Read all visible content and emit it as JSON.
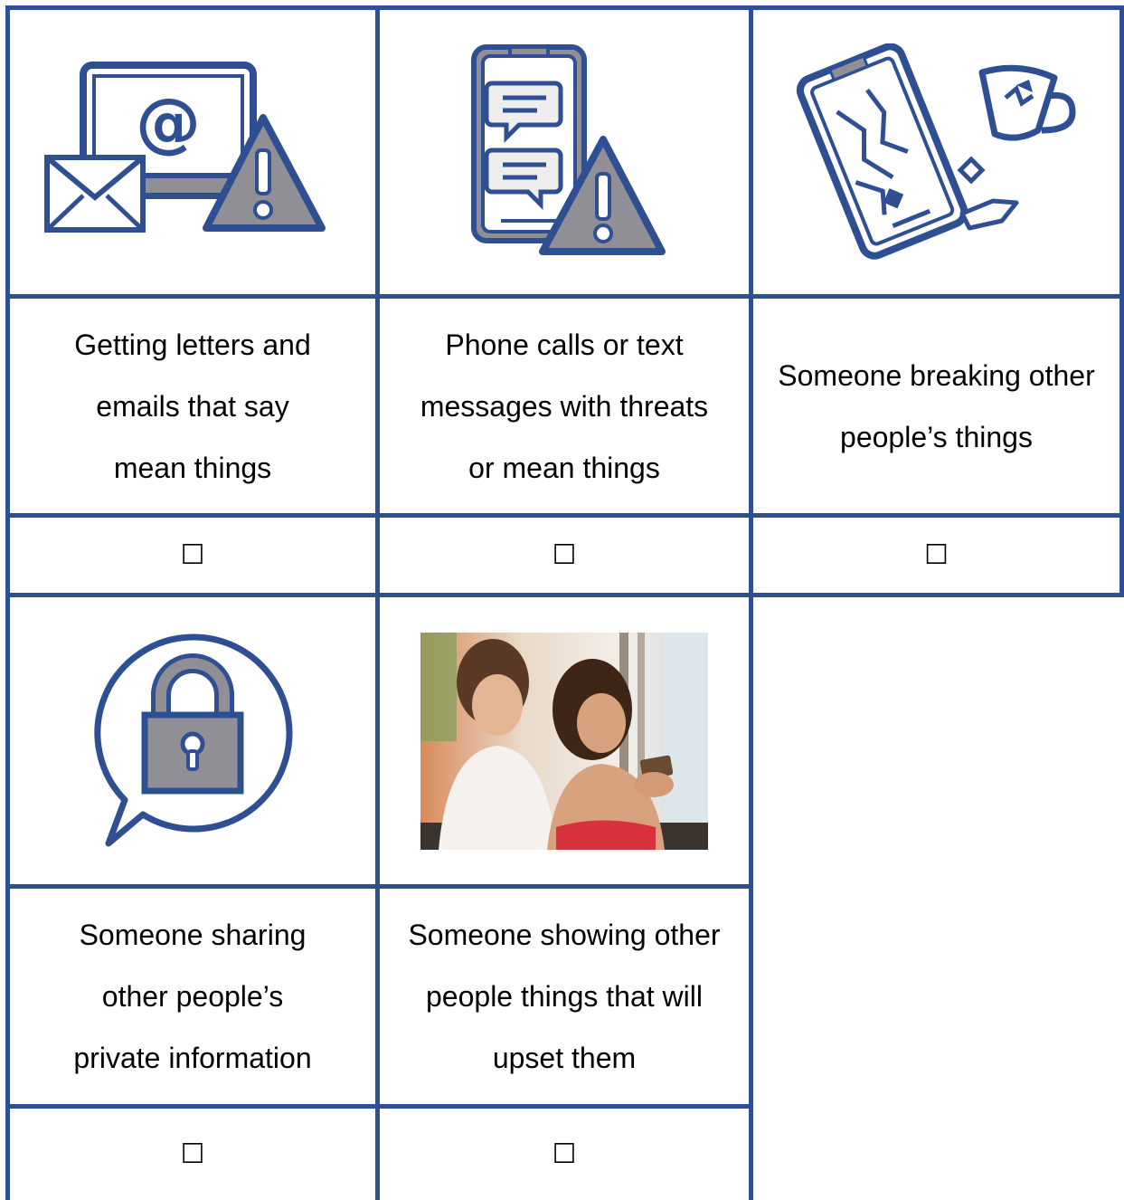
{
  "colors": {
    "border": "#2f4f93",
    "icon_stroke": "#2f4f93",
    "icon_fill": "#8f8f95",
    "paper": "#ffffff"
  },
  "items": [
    {
      "label": "Getting letters and emails that say mean things",
      "lines": [
        "Getting letters and",
        "emails that say",
        "mean things"
      ],
      "icon": "email-warning-icon",
      "checkbox": "☐"
    },
    {
      "label": "Phone calls or text messages with threats or mean things",
      "lines": [
        "Phone calls or text",
        "messages with threats",
        "or mean things"
      ],
      "icon": "phone-message-warning-icon",
      "checkbox": "☐"
    },
    {
      "label": "Someone breaking other people’s things",
      "lines": [
        "Someone breaking other",
        "people’s things"
      ],
      "icon": "broken-phone-cup-icon",
      "checkbox": "☐"
    },
    {
      "label": "Someone sharing other people’s private information",
      "lines": [
        "Someone sharing",
        "other people’s",
        "private information"
      ],
      "icon": "lock-speech-bubble-icon",
      "checkbox": "☐"
    },
    {
      "label": "Someone showing other people things that will upset them",
      "lines": [
        "Someone showing other",
        "people things that will",
        "upset them"
      ],
      "icon": "two-women-looking-at-phone-photo",
      "checkbox": "☐"
    }
  ]
}
